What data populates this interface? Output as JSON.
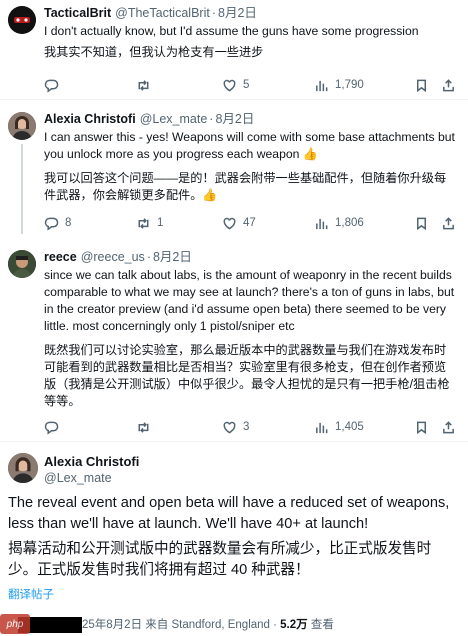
{
  "tweets": [
    {
      "name": "TacticalBrit",
      "handle": "@TheTacticalBrit",
      "date": "8月2日",
      "text": "I don't actually know, but I'd assume the guns have some progression",
      "translation": "我其实不知道，但我认为枪支有一些进步",
      "reply_count": "",
      "retweet_count": "",
      "like_count": "5",
      "view_count": "1,790",
      "avatar_color": "#1a1a1a"
    },
    {
      "name": "Alexia Christofi",
      "handle": "@Lex_mate",
      "date": "8月2日",
      "text": "I can answer this - yes! Weapons will come with some base attachments but you unlock more as you progress each weapon 👍",
      "translation": "我可以回答这个问题——是的！武器会附带一些基础配件，但随着你升级每件武器，你会解锁更多配件。👍",
      "reply_count": "8",
      "retweet_count": "1",
      "like_count": "47",
      "view_count": "1,806",
      "avatar_color": "#6b5a4e"
    },
    {
      "name": "reece",
      "handle": "@reece_us",
      "date": "8月2日",
      "text": "since we can talk about labs, is the amount of weaponry in the recent builds comparable to what we may see at launch? there's a ton of guns in labs, but in the creator preview (and i'd assume open beta) there seemed to be very little. most concerningly only 1 pistol/sniper etc",
      "translation": "既然我们可以讨论实验室，那么最近版本中的武器数量与我们在游戏发布时可能看到的武器数量相比是否相当？实验室里有很多枪支，但在创作者预览版（我猜是公开测试版）中似乎很少。最令人担忧的是只有一把手枪/狙击枪等等。",
      "reply_count": "",
      "retweet_count": "",
      "like_count": "3",
      "view_count": "1,405",
      "avatar_color": "#2f3a2a"
    }
  ],
  "main": {
    "name": "Alexia Christofi",
    "handle": "@Lex_mate",
    "text": "The reveal event and open beta will have a reduced set of weapons, less than we'll have at launch. We'll have 40+ at launch!",
    "translation": "揭幕活动和公开测试版中的武器数量会有所减少，比正式版发售时少。正式版发售时我们将拥有超过 40 种武器！",
    "translate_label": "翻译帖子",
    "meta_time": "25年8月2日 来自 Standford, England · ",
    "meta_views": "5.2万",
    "meta_views_label": " 查看"
  },
  "watermark": "php",
  "colors": {
    "link": "#1d9bf0",
    "secondary": "#536471",
    "text": "#0f1419"
  }
}
